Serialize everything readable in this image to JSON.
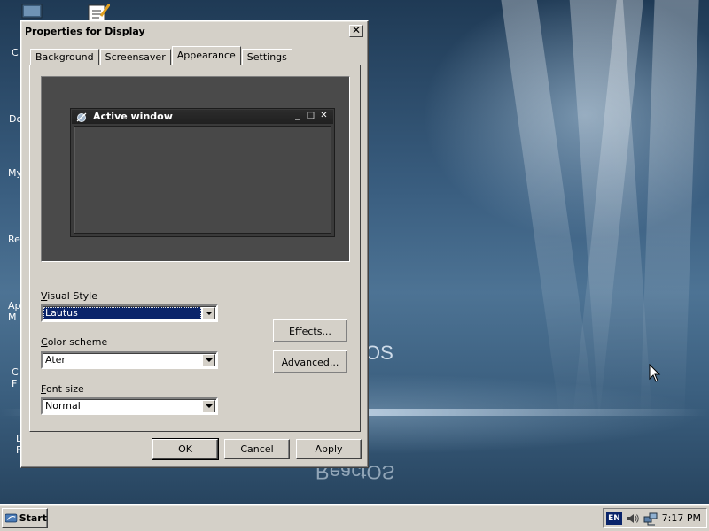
{
  "desktop": {
    "logo_text": "ReactOS",
    "icon_labels": [
      "C",
      "Do",
      "My",
      "Re",
      "Ap\nM",
      "C\nF",
      "D\nF"
    ]
  },
  "dialog": {
    "title": "Properties for Display",
    "close_glyph": "✕",
    "tabs": [
      {
        "label": "Background",
        "active": false
      },
      {
        "label": "Screensaver",
        "active": false
      },
      {
        "label": "Appearance",
        "active": true
      },
      {
        "label": "Settings",
        "active": false
      }
    ],
    "preview": {
      "window_title": "Active window"
    },
    "visual_style": {
      "label": "Visual Style",
      "value": "Lautus"
    },
    "color_scheme": {
      "label": "Color scheme",
      "value": "Ater"
    },
    "font_size": {
      "label": "Font size",
      "value": "Normal"
    },
    "effects_label": "Effects...",
    "advanced_label": "Advanced...",
    "ok_label": "OK",
    "cancel_label": "Cancel",
    "apply_label": "Apply"
  },
  "taskbar": {
    "start_label": "Start",
    "language": "EN",
    "clock": "7:17 PM"
  },
  "colors": {
    "selection": "#0a246a",
    "dialog_face": "#d4d0c8",
    "preview_bg": "#4a4a4a",
    "desktop_mid": "#4d7394"
  }
}
